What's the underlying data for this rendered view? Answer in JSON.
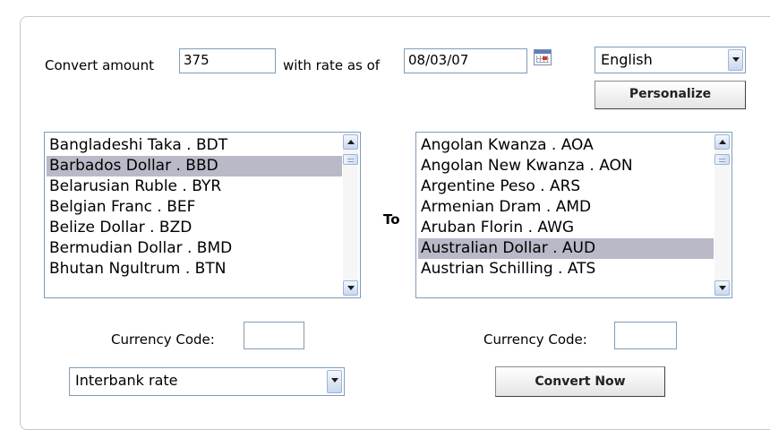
{
  "converter": {
    "convert_amount_label": "Convert amount",
    "amount_value": "375",
    "rate_as_of_label": "with rate as of",
    "date_value": "08/03/07",
    "language_selected": "English",
    "personalize_label": "Personalize",
    "to_label": "To",
    "from_list": [
      "Bangladeshi Taka . BDT",
      "Barbados Dollar . BBD",
      "Belarusian Ruble . BYR",
      "Belgian Franc . BEF",
      "Belize Dollar . BZD",
      "Bermudian Dollar . BMD",
      "Bhutan Ngultrum . BTN"
    ],
    "from_selected_index": 1,
    "to_list": [
      "Angolan Kwanza . AOA",
      "Angolan New Kwanza . AON",
      "Argentine Peso . ARS",
      "Armenian Dram . AMD",
      "Aruban Florin . AWG",
      "Australian Dollar . AUD",
      "Austrian Schilling . ATS"
    ],
    "to_selected_index": 5,
    "currency_code_label": "Currency Code:",
    "from_currency_code_value": "",
    "to_currency_code_value": "",
    "rate_type_selected": "Interbank rate",
    "convert_now_label": "Convert Now"
  },
  "colors": {
    "selection": "#b9b9c8",
    "border": "#7f9db9"
  },
  "icons": {
    "calendar": "calendar-icon",
    "dropdown": "chevron-down-icon",
    "scroll_up": "chevron-up-icon",
    "scroll_down": "chevron-down-icon"
  }
}
